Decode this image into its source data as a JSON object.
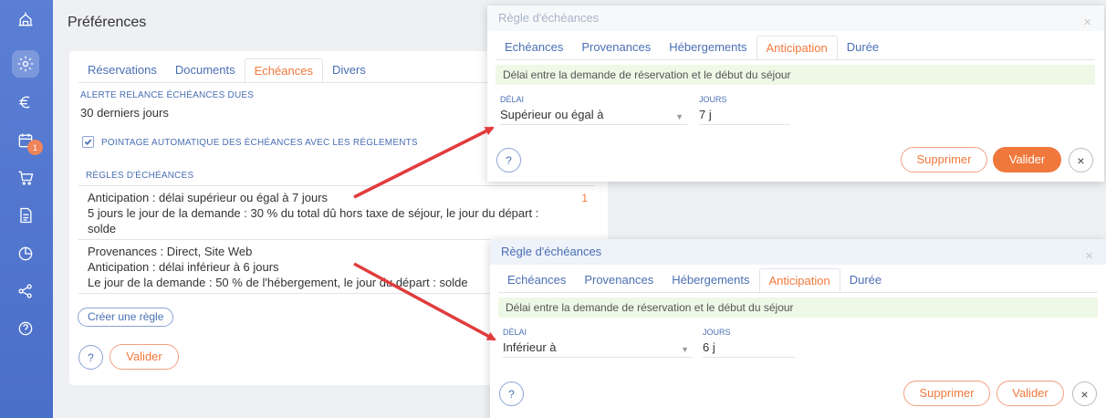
{
  "page": {
    "title": "Préférences"
  },
  "sidebar": {
    "badge": "1",
    "items": [
      {
        "icon": "home-icon"
      },
      {
        "icon": "gear-icon"
      },
      {
        "icon": "euro-icon"
      },
      {
        "icon": "calendar-icon"
      },
      {
        "icon": "cart-icon"
      },
      {
        "icon": "document-icon"
      },
      {
        "icon": "pie-chart-icon"
      },
      {
        "icon": "share-icon"
      },
      {
        "icon": "help-icon"
      }
    ]
  },
  "card": {
    "tabs": [
      "Réservations",
      "Documents",
      "Echéances",
      "Divers"
    ],
    "active_tab": "Echéances",
    "alert_label": "Alerte relance échéances dues",
    "alert_value": "30 derniers jours",
    "checkbox_label": "Pointage automatique des échéances avec les règlements",
    "rules_label": "Règles d'échéances",
    "rules": [
      {
        "line1": "Anticipation : délai supérieur ou égal à 7 jours",
        "line2": "5 jours le jour de la demande : 30 % du total dû hors taxe de séjour, le jour du départ :",
        "line3": "solde",
        "count": "1"
      },
      {
        "line1": "Provenances : Direct, Site Web",
        "line2": "Anticipation : délai inférieur à 6 jours",
        "line3": "Le jour de la demande : 50 % de l'hébergement, le jour du départ : solde",
        "count": ""
      }
    ],
    "create_rule": "Créer une règle",
    "help": "?",
    "validate": "Valider"
  },
  "modal1": {
    "title": "Règle d'échéances",
    "close": "×",
    "tabs": [
      "Echéances",
      "Provenances",
      "Hébergements",
      "Anticipation",
      "Durée"
    ],
    "active_tab": "Anticipation",
    "note": "Délai entre la demande de réservation et le début du séjour",
    "delay_label": "Délai",
    "delay_value": "Supérieur ou égal à",
    "days_label": "Jours",
    "days_value": "7 j",
    "help": "?",
    "delete": "Supprimer",
    "validate": "Valider",
    "cancel": "×"
  },
  "modal2": {
    "title": "Règle d'échéances",
    "close": "×",
    "tabs": [
      "Echéances",
      "Provenances",
      "Hébergements",
      "Anticipation",
      "Durée"
    ],
    "active_tab": "Anticipation",
    "note": "Délai entre la demande de réservation et le début du séjour",
    "delay_label": "Délai",
    "delay_value": "Inférieur à",
    "days_label": "Jours",
    "days_value": "6 j",
    "help": "?",
    "delete": "Supprimer",
    "validate": "Valider",
    "cancel": "×"
  },
  "colors": {
    "accent": "#f0783c",
    "primary": "#4a6fb4",
    "sidebar": "#5b7fd4",
    "arrow": "#e03c3c"
  }
}
